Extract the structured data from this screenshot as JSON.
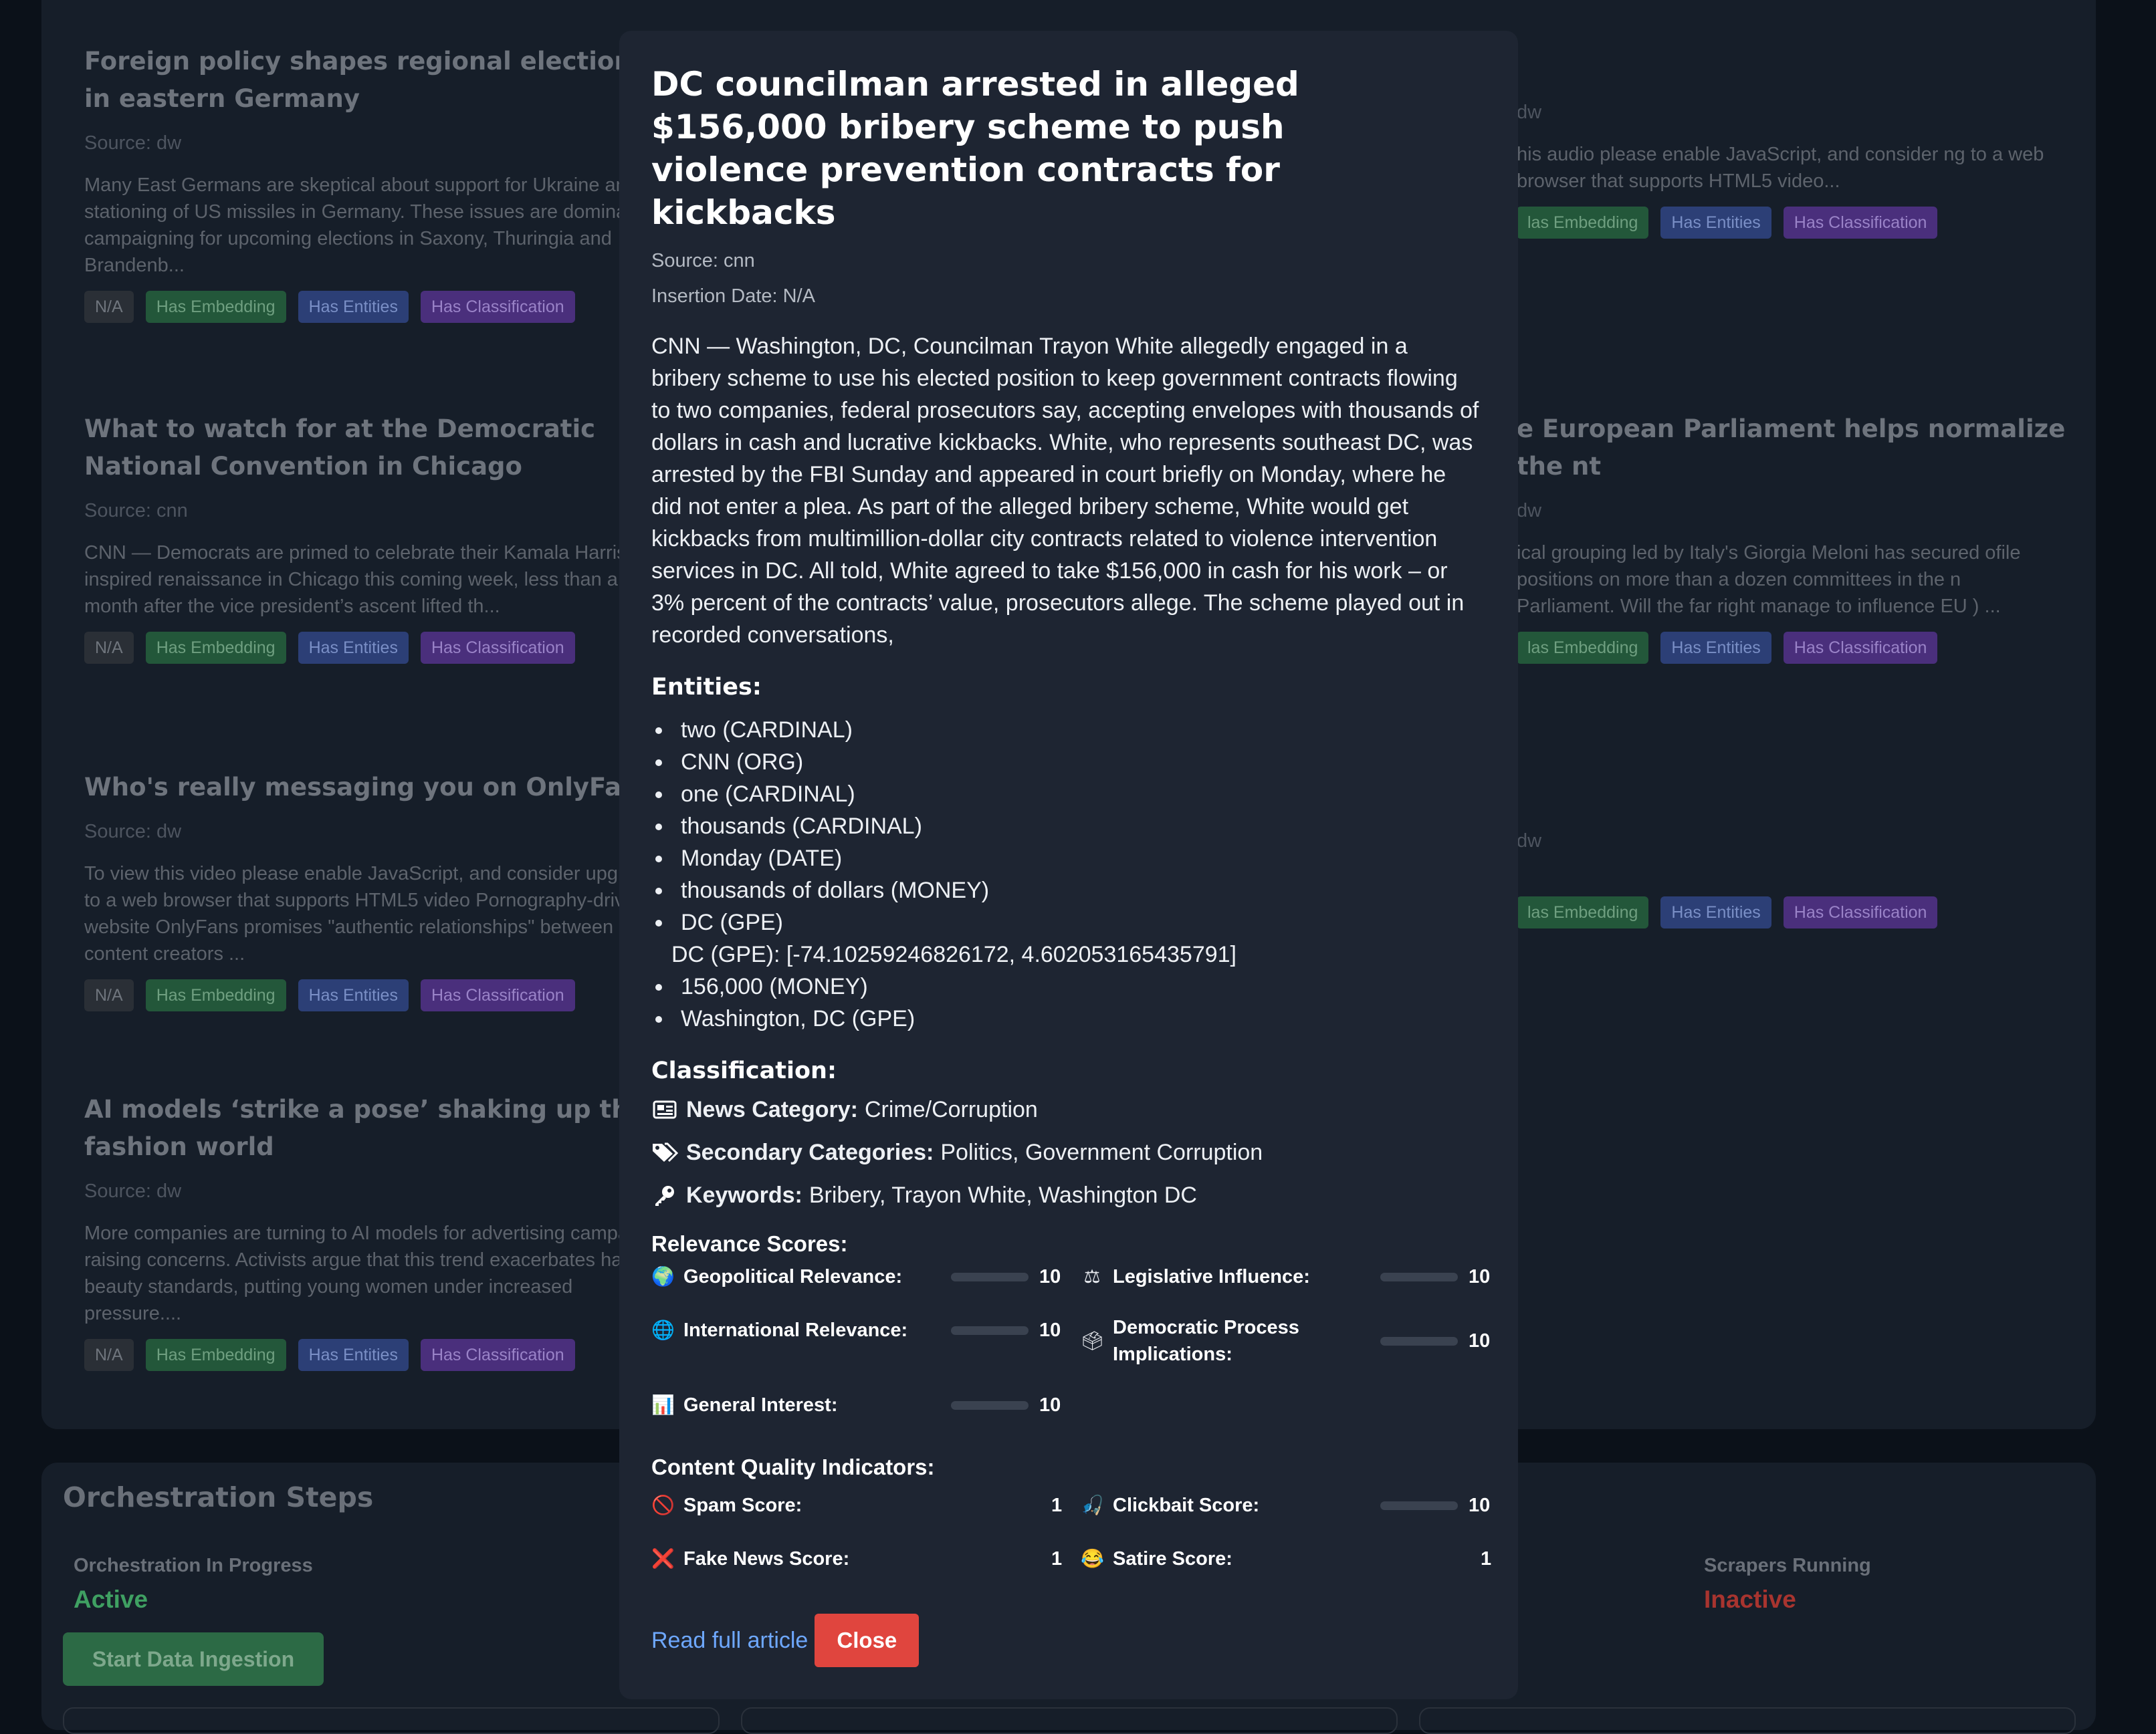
{
  "articles": [
    {
      "title": "Foreign policy shapes regional elections in eastern Germany",
      "source": "Source: dw",
      "description": "Many East Germans are skeptical about support for Ukraine and the stationing of US missiles in Germany. These issues are dominating campaigning for upcoming elections in Saxony, Thuringia and Brandenb...",
      "badges": [
        "N/A",
        "Has Embedding",
        "Has Entities",
        "Has Classification"
      ]
    },
    {
      "title": "What to watch for at the Democratic National Convention in Chicago",
      "source": "Source: cnn",
      "description": "CNN — Democrats are primed to celebrate their Kamala Harris-inspired renaissance in Chicago this coming week, less than a month after the vice president’s ascent lifted th...",
      "badges": [
        "N/A",
        "Has Embedding",
        "Has Entities",
        "Has Classification"
      ]
    },
    {
      "title": "Who's really messaging you on OnlyFans?",
      "source": "Source: dw",
      "description": "To view this video please enable JavaScript, and consider upgrading to a web browser that supports HTML5 video Pornography-driven website OnlyFans promises \"authentic relationships\" between content creators ...",
      "badges": [
        "N/A",
        "Has Embedding",
        "Has Entities",
        "Has Classification"
      ]
    },
    {
      "title": "AI models ‘strike a pose’ shaking up the fashion world",
      "source": "Source: dw",
      "description": "More companies are turning to AI models for advertising campaigns, raising concerns. Activists argue that this trend exacerbates harmful beauty standards, putting young women under increased pressure....",
      "badges": [
        "N/A",
        "Has Embedding",
        "Has Entities",
        "Has Classification"
      ]
    }
  ],
  "right_articles": [
    {
      "title": "",
      "source": "dw",
      "description": "his audio please enable JavaScript, and consider ng to a web browser that supports HTML5 video...",
      "badges": [
        "las Embedding",
        "Has Entities",
        "Has Classification"
      ]
    },
    {
      "title": "e European Parliament helps normalize the nt",
      "source": "dw",
      "description": "ical grouping led by Italy's Giorgia Meloni has secured ofile positions on more than a dozen committees in the n Parliament. Will the far right manage to influence EU ) ...",
      "badges": [
        "las Embedding",
        "Has Entities",
        "Has Classification"
      ]
    },
    {
      "title": "",
      "source": "dw",
      "description": "",
      "badges": [
        "las Embedding",
        "Has Entities",
        "Has Classification"
      ]
    }
  ],
  "orchestration": {
    "title": "Orchestration Steps",
    "in_progress_label": "Orchestration In Progress",
    "in_progress_status": "Active",
    "start_button": "Start Data Ingestion",
    "scrapers_label": "Scrapers Running",
    "scrapers_status": "Inactive",
    "active_color": "#3fa062",
    "inactive_color": "#a8342f"
  },
  "modal": {
    "title": "DC councilman arrested in alleged $156,000 bribery scheme to push violence prevention contracts for kickbacks",
    "source": "Source: cnn",
    "insertion_date": "Insertion Date: N/A",
    "content": "CNN — Washington, DC, Councilman Trayon White allegedly engaged in a bribery scheme to use his elected position to keep government contracts flowing to two companies, federal prosecutors say, accepting envelopes with thousands of dollars in cash and lucrative kickbacks. White, who represents southeast DC, was arrested by the FBI Sunday and appeared in court briefly on Monday, where he did not enter a plea. As part of the alleged bribery scheme, White would get kickbacks from multimillion-dollar city contracts related to violence intervention services in DC. All told, White agreed to take $156,000 in cash for his work – or 3% percent of the contracts’ value, prosecutors allege. The scheme played out in recorded conversations,",
    "entities_heading": "Entities:",
    "entities": [
      "two (CARDINAL)",
      "CNN (ORG)",
      "one (CARDINAL)",
      "thousands (CARDINAL)",
      "Monday (DATE)",
      "thousands of dollars (MONEY)",
      "DC (GPE)",
      "DC (GPE): [-74.10259246826172, 4.602053165435791]",
      "156,000 (MONEY)",
      "Washington, DC (GPE)"
    ],
    "classification_heading": "Classification:",
    "news_category_label": "News Category:",
    "news_category": "Crime/Corruption",
    "secondary_label": "Secondary Categories:",
    "secondary": "Politics, Government Corruption",
    "keywords_label": "Keywords:",
    "keywords": "Bribery, Trayon White, Washington DC",
    "relevance_heading": "Relevance Scores:",
    "relevance": [
      {
        "icon": "globe-icon",
        "glyph": "🌍",
        "label": "Geopolitical Relevance:",
        "value": 10
      },
      {
        "icon": "scales-icon",
        "glyph": "⚖",
        "label": "Legislative Influence:",
        "value": 10
      },
      {
        "icon": "network-globe-icon",
        "glyph": "🌐",
        "label": "International Relevance:",
        "value": 10
      },
      {
        "icon": "ballot-box-icon",
        "glyph": "🗳",
        "label": "Democratic Process Implications:",
        "value": 10
      },
      {
        "icon": "bar-chart-icon",
        "glyph": "📊",
        "label": "General Interest:",
        "value": 10
      }
    ],
    "quality_heading": "Content Quality Indicators:",
    "quality": [
      {
        "icon": "prohibited-icon",
        "glyph": "🚫",
        "label": "Spam Score:",
        "value": 1,
        "color": "#e6e8eb"
      },
      {
        "icon": "fishing-hook-icon",
        "glyph": "🎣",
        "label": "Clickbait Score:",
        "value": 10,
        "color": "#d0443c"
      },
      {
        "icon": "cross-mark-icon",
        "glyph": "❌",
        "label": "Fake News Score:",
        "value": 1,
        "color": "#e6e8eb"
      },
      {
        "icon": "laughing-face-icon",
        "glyph": "😂",
        "label": "Satire Score:",
        "value": 1,
        "color": "#e6e8eb"
      }
    ],
    "relevance_color": "#4fc94b",
    "read_full_article": "Read full article",
    "close": "Close"
  }
}
